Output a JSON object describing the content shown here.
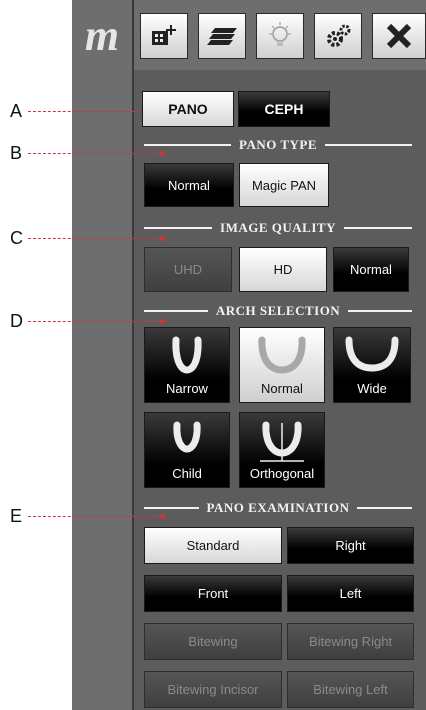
{
  "logo": "m",
  "toolbar": {
    "icons": [
      "add-image-icon",
      "layers-icon",
      "bulb-icon",
      "gears-icon",
      "close-icon"
    ]
  },
  "markers": [
    "A",
    "B",
    "C",
    "D",
    "E"
  ],
  "modes": {
    "pano": "PANO",
    "ceph": "CEPH"
  },
  "pano_type": {
    "title": "PANO TYPE",
    "normal": "Normal",
    "magic": "Magic PAN"
  },
  "image_quality": {
    "title": "IMAGE QUALITY",
    "uhd": "UHD",
    "hd": "HD",
    "normal": "Normal"
  },
  "arch_selection": {
    "title": "ARCH SELECTION",
    "narrow": "Narrow",
    "normal": "Normal",
    "wide": "Wide",
    "child": "Child",
    "orthogonal": "Orthogonal"
  },
  "pano_exam": {
    "title": "PANO EXAMINATION",
    "standard": "Standard",
    "right": "Right",
    "front": "Front",
    "left": "Left",
    "bitewing": "Bitewing",
    "bitewing_right": "Bitewing Right",
    "bitewing_incisor": "Bitewing Incisor",
    "bitewing_left": "Bitewing Left"
  },
  "colors": {
    "panel": "#5c5c5c",
    "marker": "#d0343a",
    "accent_light": "#d7d7d7"
  }
}
